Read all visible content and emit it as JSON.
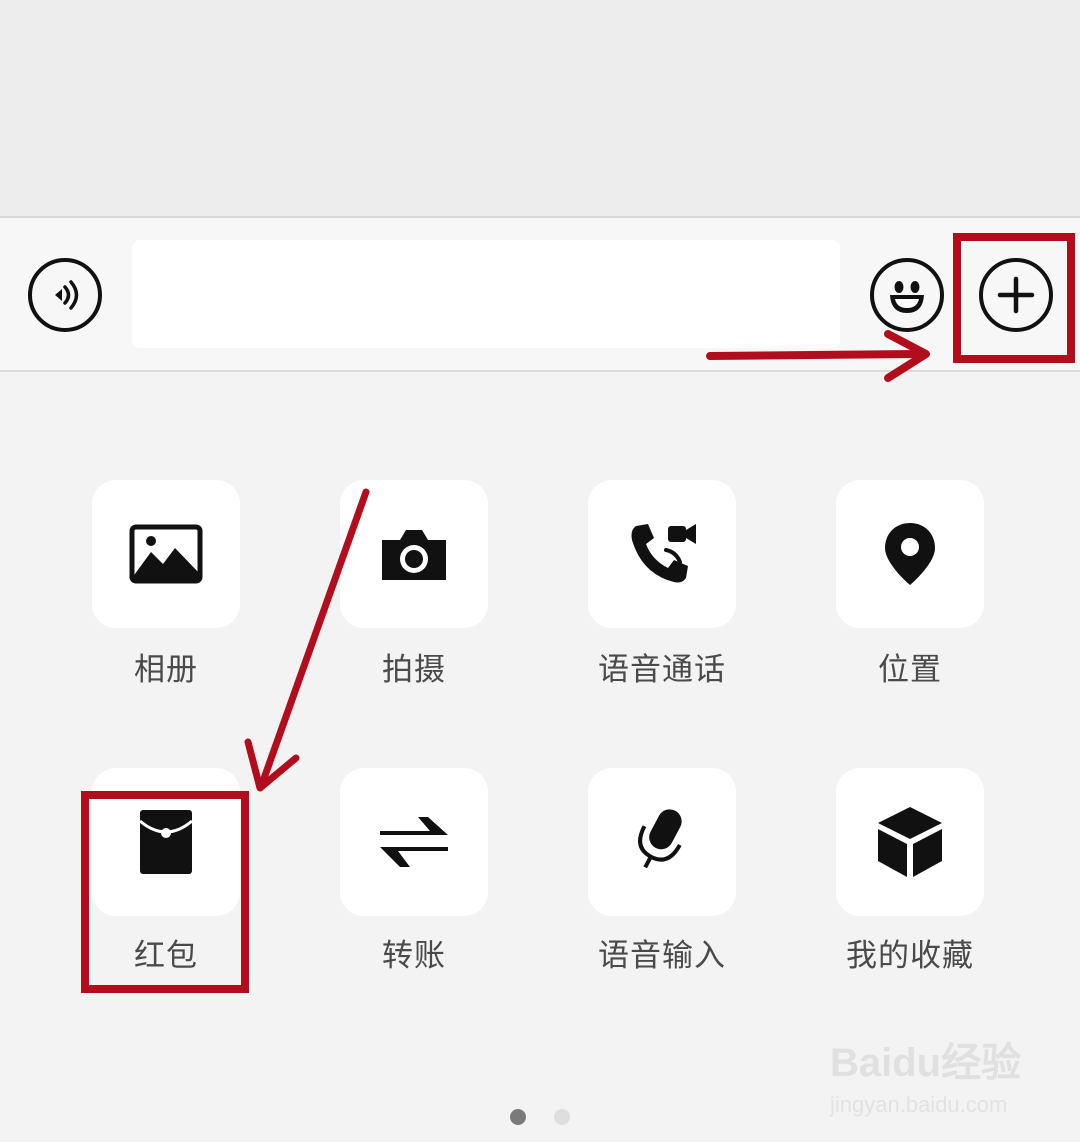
{
  "apps": [
    {
      "label": "相册",
      "icon": "photo-album-icon"
    },
    {
      "label": "拍摄",
      "icon": "camera-icon"
    },
    {
      "label": "语音通话",
      "icon": "voice-call-icon"
    },
    {
      "label": "位置",
      "icon": "location-pin-icon"
    },
    {
      "label": "红包",
      "icon": "red-packet-icon"
    },
    {
      "label": "转账",
      "icon": "transfer-icon"
    },
    {
      "label": "语音输入",
      "icon": "microphone-icon"
    },
    {
      "label": "我的收藏",
      "icon": "favorites-box-icon"
    }
  ],
  "pager": {
    "total": 2,
    "current": 1
  },
  "watermark": {
    "logo": "Baidu经验",
    "url": "jingyan.baidu.com"
  },
  "colors": {
    "annotation": "#b20d1d",
    "icon": "#111111",
    "label": "#4a4a4a",
    "tile": "#ffffff",
    "panel": "#f3f3f3",
    "chat_bg": "#ededed"
  },
  "annotations": {
    "highlight_plus": true,
    "highlight_red_packet": true
  }
}
